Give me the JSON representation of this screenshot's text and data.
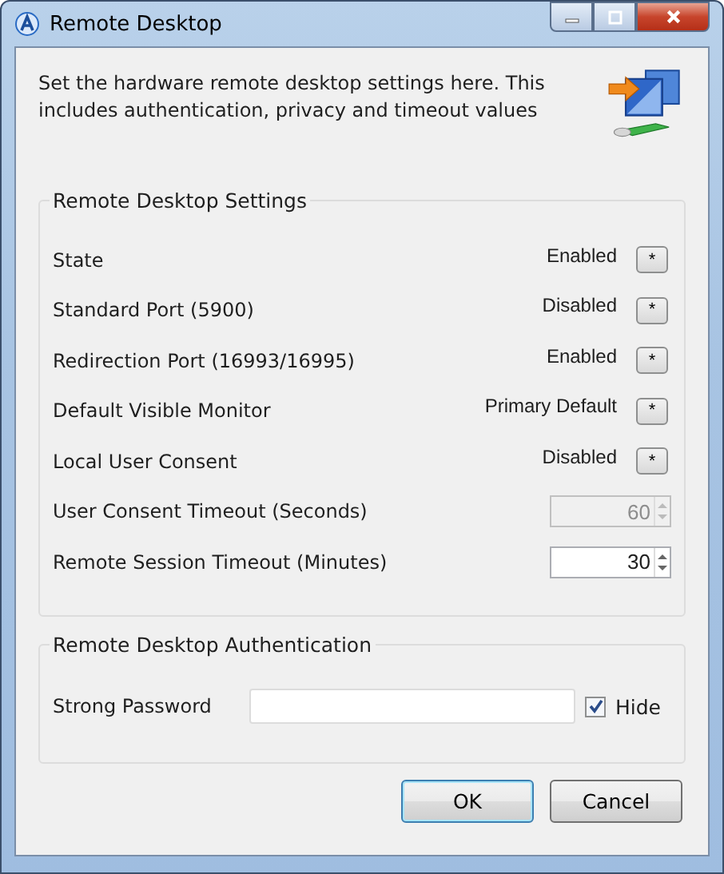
{
  "window": {
    "title": "Remote Desktop"
  },
  "description": "Set the hardware remote desktop settings here. This includes authentication, privacy and timeout values",
  "settings": {
    "title": "Remote Desktop Settings",
    "rows": [
      {
        "kind": "choice",
        "label": "State",
        "value": "Enabled",
        "button": "*"
      },
      {
        "kind": "choice",
        "label": "Standard Port (5900)",
        "value": "Disabled",
        "button": "*"
      },
      {
        "kind": "choice",
        "label": "Redirection Port (16993/16995)",
        "value": "Enabled",
        "button": "*"
      },
      {
        "kind": "choice",
        "label": "Default Visible Monitor",
        "value": "Primary Default",
        "button": "*"
      },
      {
        "kind": "choice",
        "label": "Local User Consent",
        "value": "Disabled",
        "button": "*"
      },
      {
        "kind": "spin",
        "label": "User Consent Timeout (Seconds)",
        "value": "60",
        "disabled": true
      },
      {
        "kind": "spin",
        "label": "Remote Session Timeout (Minutes)",
        "value": "30",
        "disabled": false
      }
    ]
  },
  "authentication": {
    "title": "Remote Desktop Authentication",
    "label": "Strong Password",
    "hide": {
      "label": "Hide",
      "checked": true
    }
  },
  "buttons": [
    "OK",
    "Cancel"
  ]
}
